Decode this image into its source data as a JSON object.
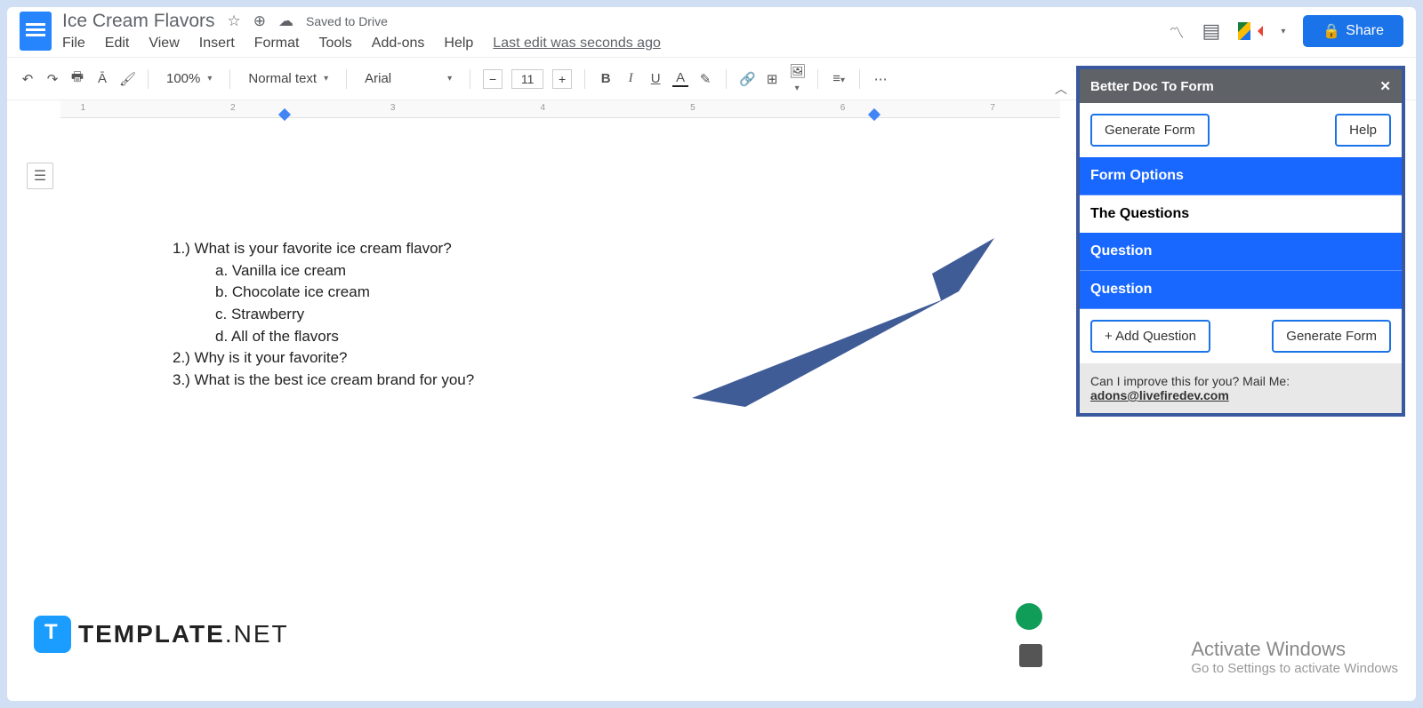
{
  "doc": {
    "title": "Ice Cream Flavors",
    "saved": "Saved to Drive",
    "last_edit": "Last edit was seconds ago"
  },
  "menu": [
    "File",
    "Edit",
    "View",
    "Insert",
    "Format",
    "Tools",
    "Add-ons",
    "Help"
  ],
  "toolbar": {
    "zoom": "100%",
    "style": "Normal text",
    "font": "Arial",
    "size": "11"
  },
  "share": "Share",
  "content": {
    "q1": "1.) What is your favorite ice cream flavor?",
    "q1a": "a.  Vanilla ice cream",
    "q1b": "b.  Chocolate ice cream",
    "q1c": "c.  Strawberry",
    "q1d": "d.  All of the flavors",
    "q2": "2.) Why is it your favorite?",
    "q3": "3.) What is the best ice cream brand for you?"
  },
  "panel": {
    "title": "Better Doc To Form",
    "gen": "Generate Form",
    "help": "Help",
    "opts": "Form Options",
    "theq": "The Questions",
    "q": "Question",
    "add": "+ Add Question",
    "gen2": "Generate Form",
    "foot1": "Can I improve this for you? Mail Me:",
    "foot2": "adons@livefiredev.com"
  },
  "wm": {
    "t": "Activate Windows",
    "s": "Go to Settings to activate Windows"
  },
  "tmpl": {
    "a": "TEMPLATE",
    "b": ".NET"
  }
}
